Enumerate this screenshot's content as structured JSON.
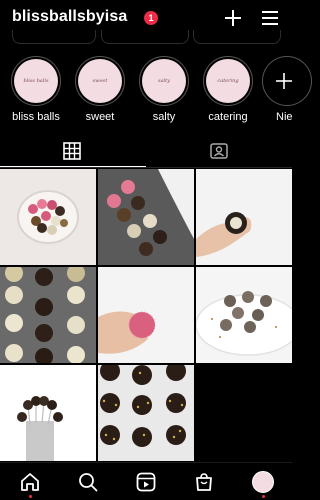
{
  "header": {
    "username": "blissballsbyisa",
    "notification_count": "1"
  },
  "highlights": [
    {
      "label": "bliss balls",
      "cover_text": "bliss balls"
    },
    {
      "label": "sweet",
      "cover_text": "sweet"
    },
    {
      "label": "salty",
      "cover_text": "salty"
    },
    {
      "label": "catering",
      "cover_text": "catering"
    },
    {
      "label": "Nie",
      "cover_text": ""
    }
  ],
  "tabs": [
    {
      "name": "grid",
      "icon": "grid-icon",
      "active": true
    },
    {
      "name": "tagged",
      "icon": "tagged-person-icon",
      "active": false
    }
  ],
  "posts": [
    {
      "subject": "bliss balls in bowl"
    },
    {
      "subject": "bliss balls on slate"
    },
    {
      "subject": "bliss ball in hand"
    },
    {
      "subject": "chocolate bliss balls rows"
    },
    {
      "subject": "pink bliss ball in hand"
    },
    {
      "subject": "bliss balls on plate"
    },
    {
      "subject": "cake pops"
    },
    {
      "subject": "chocolate balls with sprinkles"
    }
  ],
  "bottom_nav": [
    {
      "name": "home",
      "icon": "home-icon"
    },
    {
      "name": "search",
      "icon": "search-icon"
    },
    {
      "name": "reels",
      "icon": "reels-icon"
    },
    {
      "name": "shop",
      "icon": "shop-icon"
    },
    {
      "name": "profile",
      "icon": "profile-avatar"
    }
  ],
  "colors": {
    "background": "#000000",
    "badge": "#ed2c47",
    "highlight_cover": "#f4dde2"
  }
}
